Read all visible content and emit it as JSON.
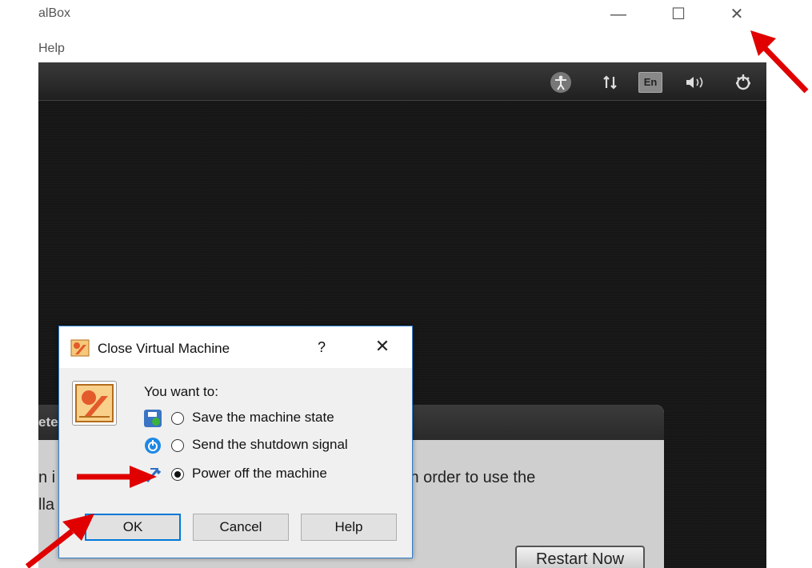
{
  "window": {
    "app_title": "alBox",
    "minimize_icon": "—",
    "maximize_icon": "☐",
    "close_icon": "✕"
  },
  "menubar": {
    "help": "Help"
  },
  "tray": {
    "accessibility_icon": "accessibility-icon",
    "network_icon": "network-icon",
    "lang": "En",
    "volume_icon": "volume-icon",
    "power_icon": "power-icon"
  },
  "installer": {
    "heading": "ete",
    "line1_left": "n i",
    "line1_right": "uter in order to use the",
    "line2": "lla",
    "restart_button": "Restart Now"
  },
  "dialog": {
    "title": "Close Virtual Machine",
    "help_glyph": "?",
    "close_glyph": "✕",
    "prompt": "You want to:",
    "options": [
      {
        "label": "Save the machine state",
        "checked": false,
        "icon": "save-state-icon"
      },
      {
        "label": "Send the shutdown signal",
        "checked": false,
        "icon": "shutdown-signal-icon"
      },
      {
        "label": "Power off the machine",
        "checked": true,
        "icon": "power-off-icon"
      }
    ],
    "ok": "OK",
    "cancel": "Cancel",
    "help": "Help"
  },
  "colors": {
    "accent": "#0078d7",
    "arrow": "#e00000",
    "guest_bg": "#161616"
  }
}
